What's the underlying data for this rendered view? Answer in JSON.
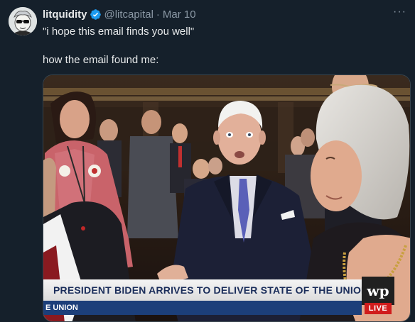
{
  "tweet": {
    "author_name": "litquidity",
    "handle": "@litcapital",
    "separator": "·",
    "date": "Mar 10",
    "line1": "\"i hope this email finds you well\"",
    "line2": "how the email found me:",
    "more_label": "···",
    "avatar_icon": "avatar-cartoon-sunglasses",
    "verified_color": "#1d9bf0"
  },
  "media": {
    "banner_text": "PRESIDENT BIDEN ARRIVES TO DELIVER STATE OF THE UNION",
    "ticker_text": "E UNION",
    "network_logo": "wp",
    "live_label": "LIVE",
    "banner_text_color": "#1a2d5a",
    "ticker_color": "#1c3f7a",
    "live_color": "#d01c1c"
  }
}
